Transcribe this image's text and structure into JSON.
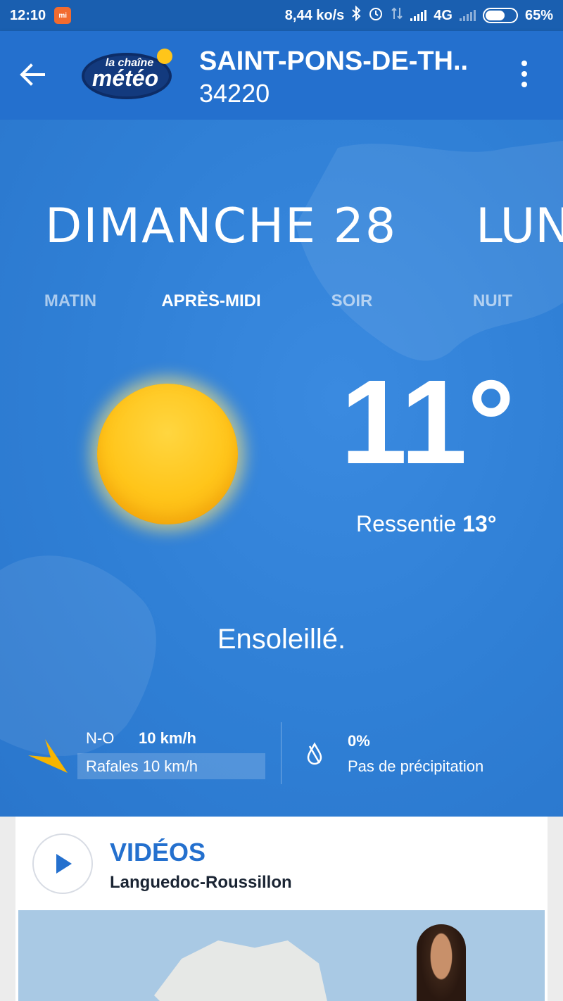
{
  "status_bar": {
    "time": "12:10",
    "network_speed": "8,44 ko/s",
    "network_type": "4G",
    "battery_pct": "65%",
    "battery_level": 0.65
  },
  "app_bar": {
    "logo_top": "la chaîne",
    "logo_main": "météo",
    "city": "SAINT-PONS-DE-TH..",
    "zip": "34220"
  },
  "forecast": {
    "day_current": "DIMANCHE 28",
    "day_next": "LUN",
    "periods": [
      "MATIN",
      "APRÈS-MIDI",
      "SOIR",
      "NUIT"
    ],
    "active_period": "APRÈS-MIDI",
    "temperature": "11°",
    "feels_label": "Ressentie",
    "feels_value": "13°",
    "condition": "Ensoleillé.",
    "wind_dir": "N-O",
    "wind_speed": "10 km/h",
    "gusts": "Rafales 10 km/h",
    "precip_pct": "0%",
    "precip_text": "Pas de précipitation"
  },
  "videos": {
    "title": "VIDÉOS",
    "region": "Languedoc-Roussillon"
  },
  "colors": {
    "app_bar": "#2470ce",
    "status_bar": "#1a5fb0",
    "hero_bg": "#2f80d6",
    "sun": "#ffc51a",
    "wind_arrow": "#f7b500",
    "accent_text": "#2470ce"
  },
  "icons": [
    "back-arrow-icon",
    "more-vert-icon",
    "sun-icon",
    "wind-direction-icon",
    "raindrop-icon",
    "play-icon",
    "bluetooth-icon",
    "alarm-icon",
    "signal-icon"
  ]
}
